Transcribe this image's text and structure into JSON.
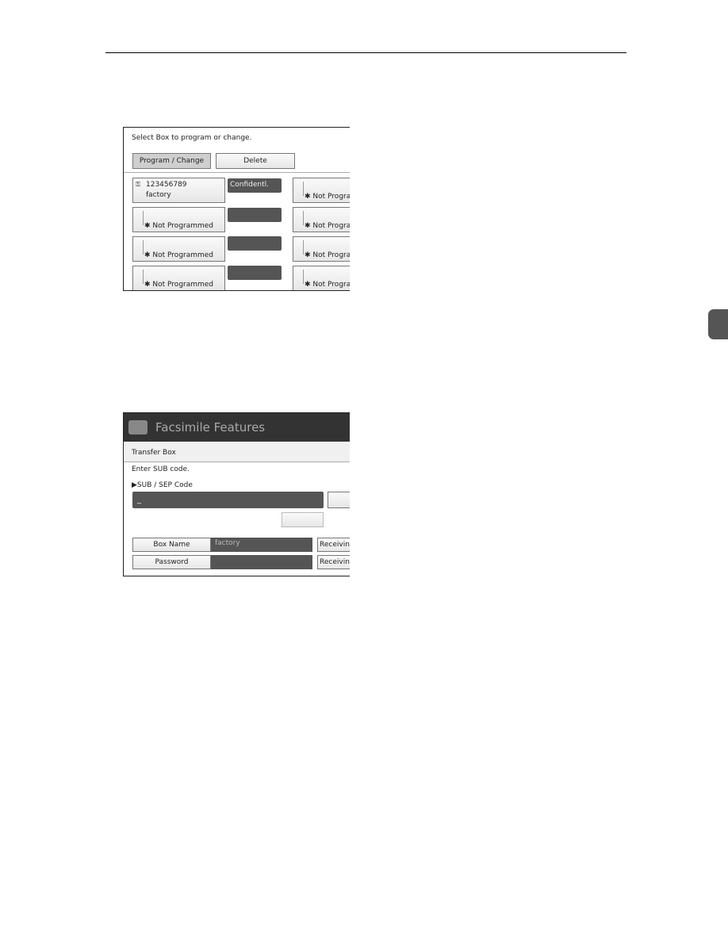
{
  "screen1": {
    "prompt": "Select Box to program or change.",
    "program_change": "Program / Change",
    "delete": "Delete",
    "box1": {
      "number": "123456789",
      "name": "factory",
      "type": "Confidentl."
    },
    "not_programmed": "Not Programmed",
    "not_programmed_truncated": "Not Progra"
  },
  "screen2": {
    "title": "Facsimile Features",
    "section": "Transfer Box",
    "prompt": "Enter SUB code.",
    "field_label": "SUB / SEP Code",
    "field_value": "_",
    "box_name_label": "Box Name",
    "box_name_value": "factory",
    "password_label": "Password",
    "receiving": "Receiving"
  }
}
